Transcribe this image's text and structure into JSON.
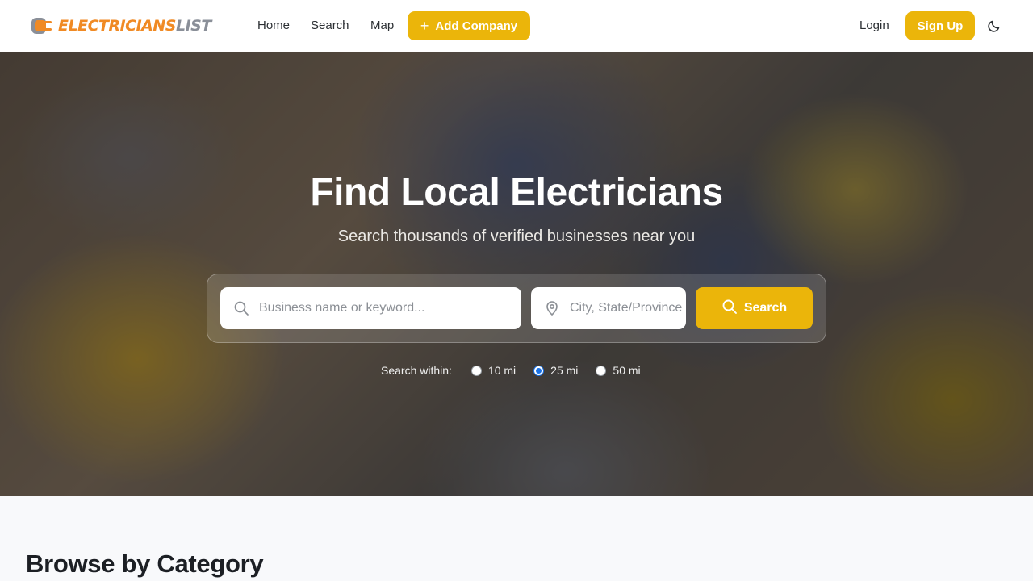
{
  "brand": {
    "name_part1": "ELECTRICIANS",
    "name_part2": "LIST",
    "accent": "#f08a24",
    "secondary": "#8a8f98"
  },
  "nav": {
    "links": [
      {
        "label": "Home"
      },
      {
        "label": "Search"
      },
      {
        "label": "Map"
      }
    ],
    "add_company_label": "Add Company",
    "login_label": "Login",
    "signup_label": "Sign Up",
    "theme_icon": "moon-icon",
    "button_color": "#ebb50a"
  },
  "hero": {
    "title": "Find Local Electricians",
    "subtitle": "Search thousands of verified businesses near you",
    "search": {
      "keyword_placeholder": "Business name or keyword...",
      "keyword_value": "",
      "location_placeholder": "City, State/Province",
      "location_value": "",
      "button_label": "Search"
    },
    "radius": {
      "label": "Search within:",
      "options": [
        {
          "label": "10 mi",
          "selected": false
        },
        {
          "label": "25 mi",
          "selected": true
        },
        {
          "label": "50 mi",
          "selected": false
        }
      ]
    }
  },
  "sections": {
    "browse_title": "Browse by Category"
  }
}
